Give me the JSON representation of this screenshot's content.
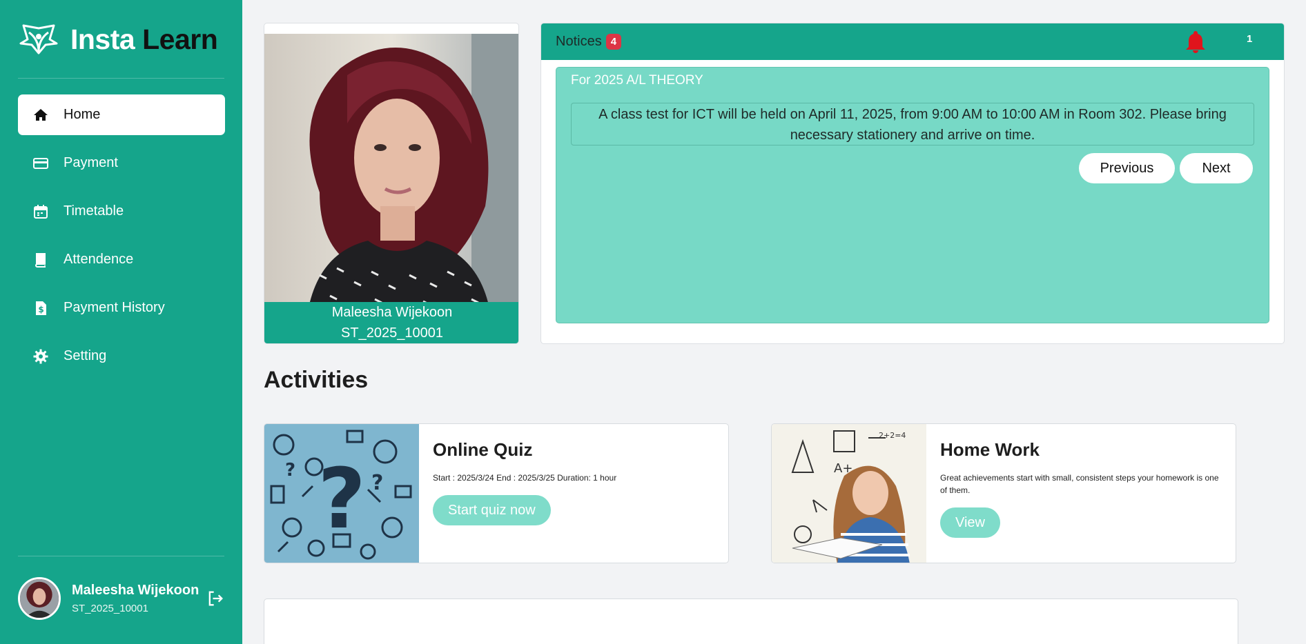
{
  "brand": {
    "name_part1": "Insta",
    "name_part2": "Learn"
  },
  "sidebar": {
    "items": [
      {
        "label": "Home",
        "icon": "home-icon",
        "active": true
      },
      {
        "label": "Payment",
        "icon": "credit-card-icon",
        "active": false
      },
      {
        "label": "Timetable",
        "icon": "calendar-icon",
        "active": false
      },
      {
        "label": "Attendence",
        "icon": "book-icon",
        "active": false
      },
      {
        "label": "Payment History",
        "icon": "invoice-dollar-icon",
        "active": false
      },
      {
        "label": "Setting",
        "icon": "gear-icon",
        "active": false
      }
    ],
    "user": {
      "name": "Maleesha Wijekoon",
      "id": "ST_2025_10001"
    }
  },
  "profile": {
    "name": "Maleesha Wijekoon",
    "id": "ST_2025_10001"
  },
  "notices": {
    "title": "Notices",
    "badge": "4",
    "bell_count": "1",
    "category": "For 2025 A/L THEORY",
    "text": "A class test for ICT will be held on April 11, 2025, from 9:00 AM to 10:00 AM in Room 302. Please bring necessary stationery and arrive on time.",
    "prev_label": "Previous",
    "next_label": "Next"
  },
  "activities": {
    "title": "Activities",
    "cards": [
      {
        "name": "Online Quiz",
        "desc": "Start : 2025/3/24 End : 2025/3/25 Duration: 1 hour",
        "button": "Start quiz now"
      },
      {
        "name": "Home Work",
        "desc": "Great achievements start with small, consistent steps your homework is one of them.",
        "button": "View"
      }
    ]
  },
  "colors": {
    "primary": "#15a58b",
    "notice_bg": "#77d9c6",
    "badge": "#dc3545",
    "bell": "#e0141c"
  }
}
